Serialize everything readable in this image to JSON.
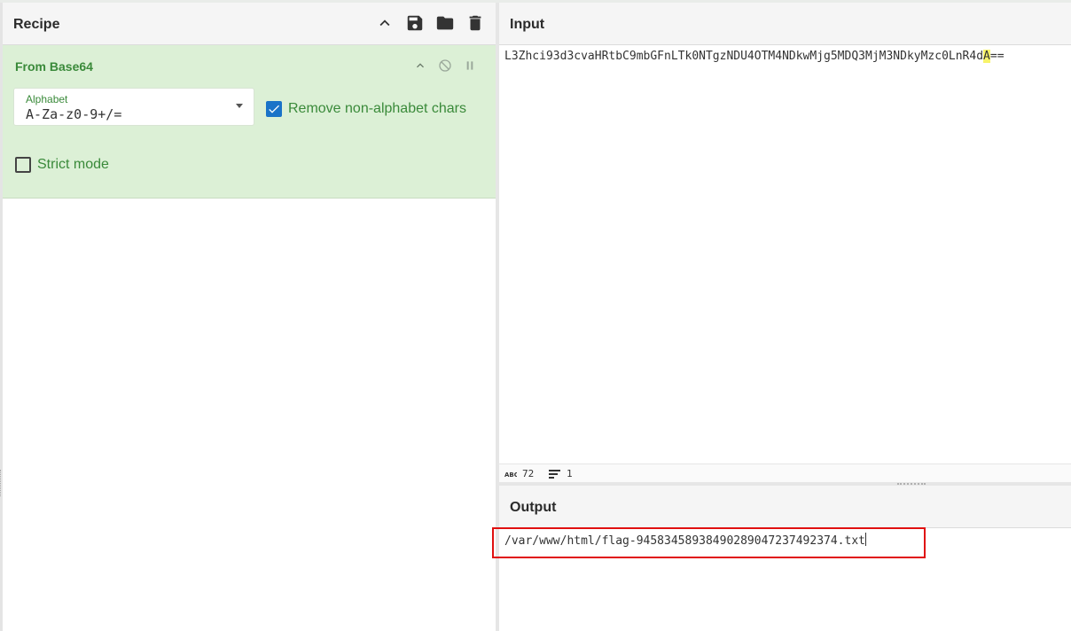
{
  "recipe": {
    "title": "Recipe",
    "operation": {
      "name": "From Base64",
      "alphabet_label": "Alphabet",
      "alphabet_value": "A-Za-z0-9+/=",
      "remove_non_alphabet_label": "Remove non-alphabet chars",
      "remove_non_alphabet_checked": true,
      "strict_mode_label": "Strict mode",
      "strict_mode_checked": false
    }
  },
  "input": {
    "title": "Input",
    "text_before": "L3Zhci93d3cvaHRtbC9mbGFnLTk0NTgzNDU4OTM4NDkwMjg5MDQ3MjM3NDkyMzc0LnR4d",
    "text_highlight": "A",
    "text_after": "==",
    "status_length": "72",
    "status_lines": "1"
  },
  "output": {
    "title": "Output",
    "text": "/var/www/html/flag-94583458938490289047237492374.txt"
  },
  "colors": {
    "operation_bg": "#dcf0d6",
    "operation_text": "#3a8a3a",
    "checkbox_checked": "#1a73c8",
    "highlight": "#f7f36a",
    "annotation_box": "#e01010"
  }
}
